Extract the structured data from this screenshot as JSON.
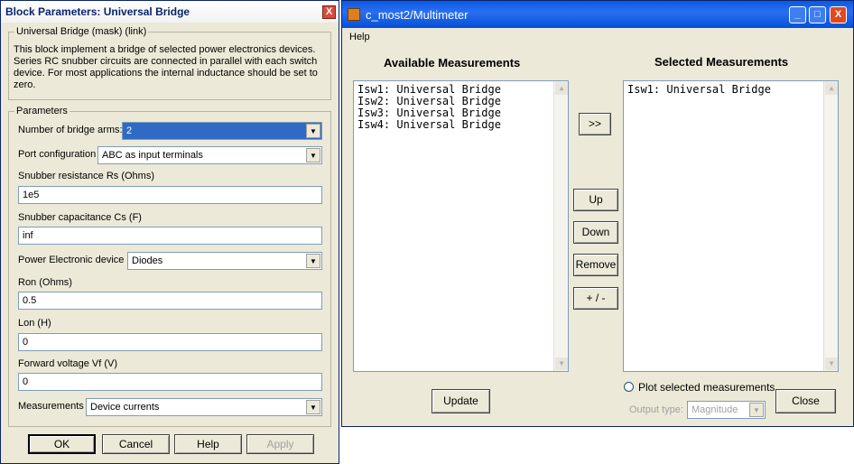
{
  "block_params": {
    "title": "Block Parameters: Universal Bridge",
    "mask_group_label": "Universal Bridge (mask) (link)",
    "description": "This block implement a bridge of selected power electronics devices. Series RC snubber circuits are connected in parallel with each switch device. For most applications the internal inductance should be set to zero.",
    "params_group_label": "Parameters",
    "fields": {
      "bridge_arms": {
        "label": "Number of bridge arms:",
        "value": "2"
      },
      "port_config": {
        "label": "Port configuration",
        "value": "ABC as input terminals"
      },
      "snubber_rs": {
        "label": "Snubber resistance Rs (Ohms)",
        "value": "1e5"
      },
      "snubber_cs": {
        "label": "Snubber capacitance Cs (F)",
        "value": "inf"
      },
      "device": {
        "label": "Power Electronic device",
        "value": "Diodes"
      },
      "ron": {
        "label": "Ron (Ohms)",
        "value": "0.5"
      },
      "lon": {
        "label": "Lon (H)",
        "value": "0"
      },
      "vf": {
        "label": "Forward voltage Vf (V)",
        "value": "0"
      },
      "measurements": {
        "label": "Measurements",
        "value": "Device currents"
      }
    },
    "buttons": {
      "ok": "OK",
      "cancel": "Cancel",
      "help": "Help",
      "apply": "Apply"
    },
    "close_glyph": "X"
  },
  "multimeter": {
    "title": "c_most2/Multimeter",
    "menu_help": "Help",
    "available_heading": "Available Measurements",
    "selected_heading": "Selected Measurements",
    "available_items": [
      "Isw1: Universal Bridge",
      "Isw2: Universal Bridge",
      "Isw3: Universal Bridge",
      "Isw4: Universal Bridge"
    ],
    "selected_items": [
      "Isw1: Universal Bridge"
    ],
    "buttons": {
      "add": ">>",
      "up": "Up",
      "down": "Down",
      "remove": "Remove",
      "plusminus": "+ / -",
      "update": "Update",
      "close": "Close"
    },
    "plot_label": "Plot selected measurements",
    "output_type_label": "Output type:",
    "output_type_value": "Magnitude",
    "title_buttons": {
      "minimize": "_",
      "maximize": "□",
      "close": "X"
    }
  }
}
